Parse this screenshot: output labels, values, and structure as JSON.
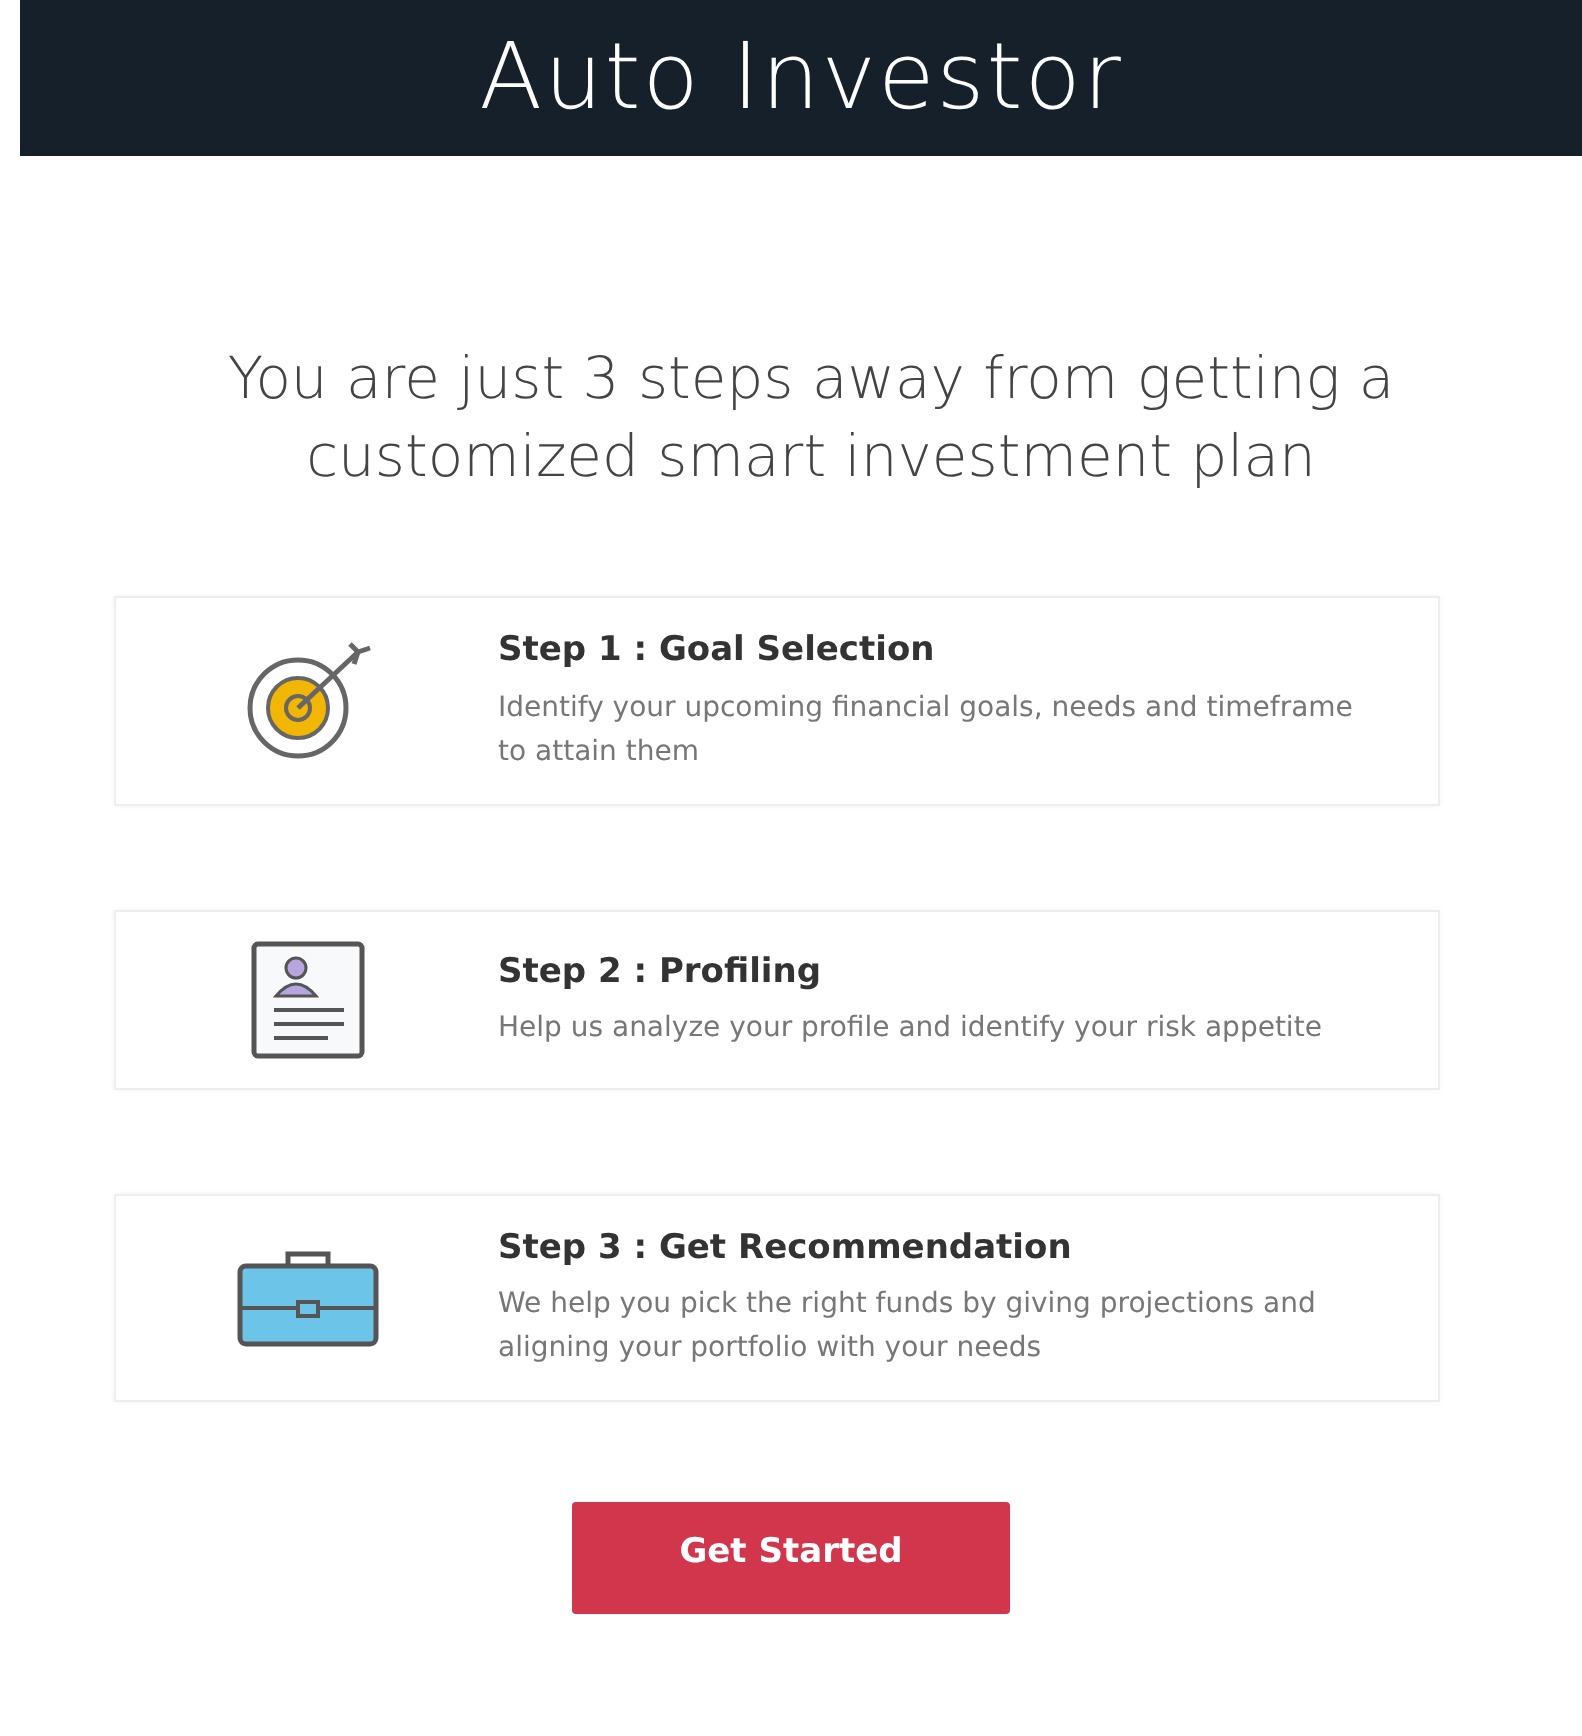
{
  "header": {
    "title": "Auto Investor"
  },
  "headline": "You are just 3 steps away from getting a customized smart investment plan",
  "steps": [
    {
      "title": "Step 1 : Goal Selection",
      "description": "Identify your upcoming financial goals, needs and timeframe to attain them"
    },
    {
      "title": "Step 2 : Profiling",
      "description": "Help us analyze your profile and identify your risk appetite"
    },
    {
      "title": "Step 3 : Get Recommendation",
      "description": "We help you pick the right funds by giving projections and aligning your portfolio with your needs"
    }
  ],
  "button": "Get Started"
}
